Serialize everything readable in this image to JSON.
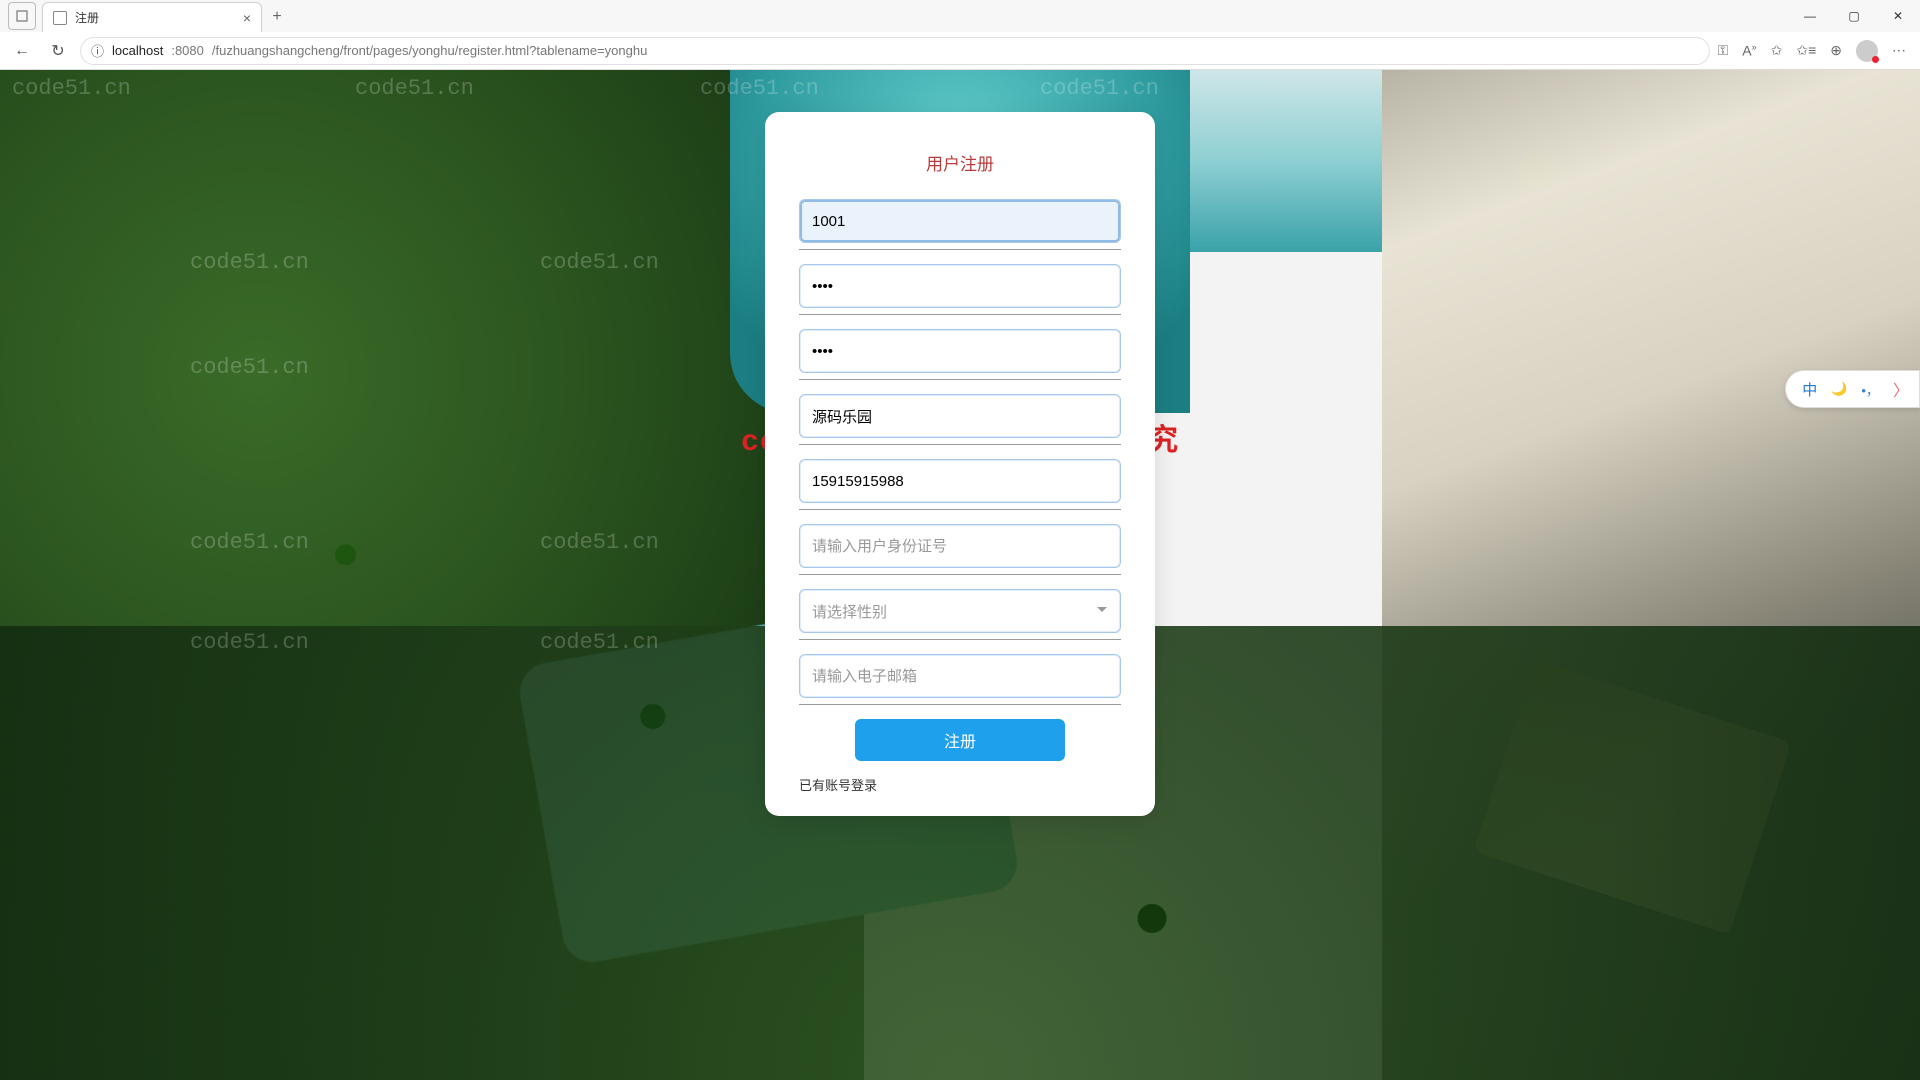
{
  "browser": {
    "tab_title": "注册",
    "url_host": "localhost",
    "url_port": ":8080",
    "url_path": "/fuzhuangshangcheng/front/pages/yonghu/register.html?tablename=yonghu"
  },
  "page": {
    "title": "用户注册",
    "fields": {
      "username": {
        "value": "1001"
      },
      "password": {
        "value": "••••"
      },
      "password_confirm": {
        "value": "••••"
      },
      "nickname": {
        "value": "源码乐园"
      },
      "phone": {
        "value": "15915915988"
      },
      "idcard": {
        "value": "",
        "placeholder": "请输入用户身份证号"
      },
      "gender": {
        "value": "",
        "placeholder": "请选择性别"
      },
      "email": {
        "value": "",
        "placeholder": "请输入电子邮箱"
      }
    },
    "submit_label": "注册",
    "login_link_label": "已有账号登录"
  },
  "watermark": {
    "repeat": "code51.cn",
    "main": "code51.cn-源码乐园盗图必究"
  },
  "ime": {
    "lang": "中",
    "moon": "🌙",
    "punct": "•，"
  }
}
